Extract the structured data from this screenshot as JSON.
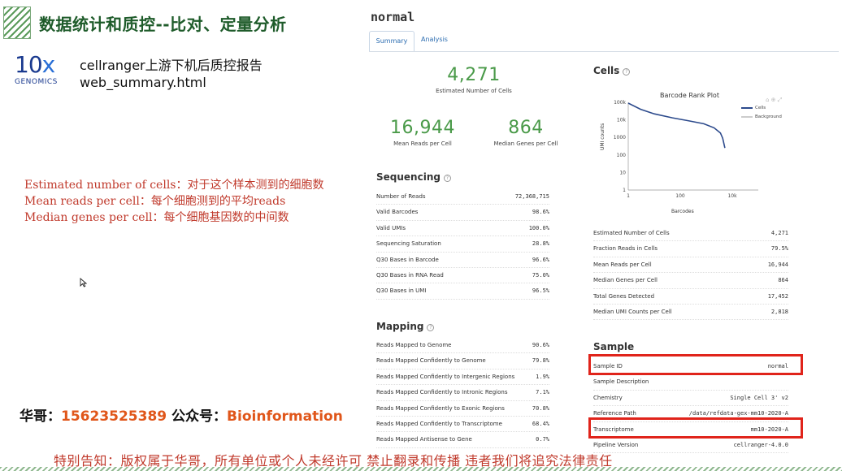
{
  "slide": {
    "title": "数据统计和质控--比对、定量分析",
    "logo": {
      "big": "10",
      "x": "x",
      "small": "GENOMICS"
    },
    "report_desc": [
      "cellranger上游下机后质控报告",
      "web_summary.html"
    ],
    "notes": [
      "Estimated number of cells：对于这个样本测到的细胞数",
      "Mean reads per cell：每个细胞测到的平均reads",
      "Median genes per cell：每个细胞基因数的中间数"
    ],
    "contact": {
      "prefix": "华哥：",
      "phone": "15623525389",
      "mid": " 公众号：",
      "account": "Bioinformation"
    },
    "footer": "特别告知：版权属于华哥，所有单位或个人未经许可 禁止翻录和传播 违者我们将追究法律责任"
  },
  "web_summary": {
    "title": "normal",
    "tabs": [
      "Summary",
      "Analysis"
    ],
    "headline": [
      {
        "value": "4,271",
        "label": "Estimated Number of Cells"
      },
      {
        "value": "16,944",
        "label": "Mean Reads per Cell"
      },
      {
        "value": "864",
        "label": "Median Genes per Cell"
      }
    ],
    "sequencing": {
      "title": "Sequencing",
      "rows": [
        {
          "label": "Number of Reads",
          "value": "72,368,715"
        },
        {
          "label": "Valid Barcodes",
          "value": "98.6%"
        },
        {
          "label": "Valid UMIs",
          "value": "100.0%"
        },
        {
          "label": "Sequencing Saturation",
          "value": "28.8%"
        },
        {
          "label": "Q30 Bases in Barcode",
          "value": "96.6%"
        },
        {
          "label": "Q30 Bases in RNA Read",
          "value": "75.0%"
        },
        {
          "label": "Q30 Bases in UMI",
          "value": "96.5%"
        }
      ]
    },
    "mapping": {
      "title": "Mapping",
      "rows": [
        {
          "label": "Reads Mapped to Genome",
          "value": "90.6%"
        },
        {
          "label": "Reads Mapped Confidently to Genome",
          "value": "79.8%"
        },
        {
          "label": "Reads Mapped Confidently to Intergenic Regions",
          "value": "1.9%"
        },
        {
          "label": "Reads Mapped Confidently to Intronic Regions",
          "value": "7.1%"
        },
        {
          "label": "Reads Mapped Confidently to Exonic Regions",
          "value": "70.8%"
        },
        {
          "label": "Reads Mapped Confidently to Transcriptome",
          "value": "68.4%"
        },
        {
          "label": "Reads Mapped Antisense to Gene",
          "value": "0.7%"
        }
      ]
    },
    "cells": {
      "title": "Cells",
      "rows": [
        {
          "label": "Estimated Number of Cells",
          "value": "4,271"
        },
        {
          "label": "Fraction Reads in Cells",
          "value": "79.5%"
        },
        {
          "label": "Mean Reads per Cell",
          "value": "16,944"
        },
        {
          "label": "Median Genes per Cell",
          "value": "864"
        },
        {
          "label": "Total Genes Detected",
          "value": "17,452"
        },
        {
          "label": "Median UMI Counts per Cell",
          "value": "2,818"
        }
      ]
    },
    "sample": {
      "title": "Sample",
      "rows": [
        {
          "label": "Sample ID",
          "value": "normal"
        },
        {
          "label": "Sample Description",
          "value": ""
        },
        {
          "label": "Chemistry",
          "value": "Single Cell 3' v2"
        },
        {
          "label": "Reference Path",
          "value": "/data/refdata-gex-mm10-2020-A"
        },
        {
          "label": "Transcriptome",
          "value": "mm10-2020-A"
        },
        {
          "label": "Pipeline Version",
          "value": "cellranger-4.0.0"
        }
      ]
    },
    "highlight_color": "#e0241b",
    "accent_green": "#4a9a49",
    "link_blue": "#2b6cb0"
  },
  "chart_data": {
    "type": "line",
    "title": "Barcode Rank Plot",
    "xlabel": "Barcodes",
    "ylabel": "UMI counts",
    "x_scale": "log",
    "y_scale": "log",
    "xlim": [
      1,
      100000
    ],
    "ylim": [
      1,
      100000
    ],
    "x_ticks": [
      "1",
      "100",
      "10k"
    ],
    "y_ticks": [
      "100k",
      "10k",
      "1000",
      "100",
      "10",
      "1"
    ],
    "legend": [
      "Cells",
      "Background"
    ],
    "legend_position": "top-right",
    "series": [
      {
        "name": "Cells",
        "color": "#2c4a8c",
        "points": [
          {
            "x": 1,
            "y": 90000
          },
          {
            "x": 3,
            "y": 40000
          },
          {
            "x": 10,
            "y": 22000
          },
          {
            "x": 50,
            "y": 13000
          },
          {
            "x": 200,
            "y": 9000
          },
          {
            "x": 800,
            "y": 6000
          },
          {
            "x": 2000,
            "y": 3500
          },
          {
            "x": 3500,
            "y": 1800
          },
          {
            "x": 4271,
            "y": 900
          },
          {
            "x": 5200,
            "y": 250
          }
        ]
      }
    ]
  }
}
